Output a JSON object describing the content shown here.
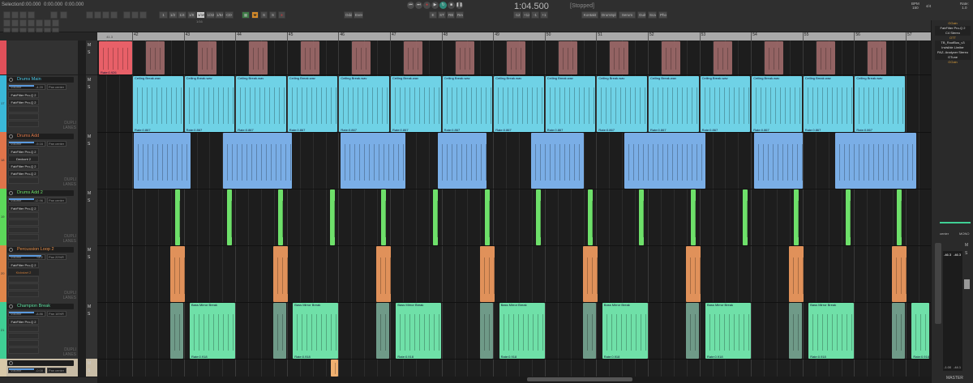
{
  "selection": {
    "label": "Selection:",
    "start": "0:00.000",
    "end": "0:00.000",
    "length": "0:00.000"
  },
  "toolbar": {
    "grid": [
      "1",
      "1/2",
      "1/4",
      "1/8",
      "1/16",
      "1/32",
      "1/64",
      "<3>"
    ],
    "grid_active": "1/16",
    "m_label": "M",
    "s1_label": "S",
    "s2_label": "S",
    "odd": "Odd",
    "even": "Even",
    "edit_btns": [
      "E",
      "ST",
      "RB",
      "Rev"
    ],
    "pitch_btns": [
      "-12",
      "+12",
      "-1",
      "+1"
    ],
    "fx_btns": [
      "Kontakt",
      "DrumSpl",
      "Serum",
      "Guit",
      "Scal",
      "Pho"
    ]
  },
  "transport": {
    "time": "1:04.500",
    "status": "[Stopped]"
  },
  "tempo": {
    "bpm_label": "BPM",
    "bpm": "150",
    "sig": "4/4",
    "rate_label": "Rate:",
    "rate": "1.0"
  },
  "ruler": {
    "bars": [
      "42",
      "43",
      "44",
      "45",
      "46",
      "47",
      "48",
      "49",
      "50",
      "51",
      "52",
      "53",
      "54",
      "55",
      "56",
      "57"
    ],
    "first_half": "41.3"
  },
  "tracks": [
    {
      "name": "",
      "color": "#e0505a",
      "num": "",
      "fx": []
    },
    {
      "name": "Drums Main",
      "color": "#3ab8d8",
      "text_color": "#4cc9e8",
      "num": "17",
      "volume": "-4.20",
      "pan": "center",
      "fx": [
        "FabFilter Pro-Q 2",
        "FabFilter Pro-Q 2"
      ]
    },
    {
      "name": "Drums Add",
      "color": "#e0744a",
      "text_color": "#e07a4a",
      "num": "18",
      "volume": "-9.16",
      "pan": "center",
      "fx": [
        "FabFilter Pro-Q 2",
        "Deckont 2",
        "FabFilter Pro-Q 2",
        "FabFilter Pro-Q 2"
      ]
    },
    {
      "name": "Drums Add 2",
      "color": "#5cd85a",
      "text_color": "#6ee06a",
      "num": "19",
      "volume": "-12.96",
      "pan": "center",
      "fx": [
        "FabFilter Pro-Q 2"
      ]
    },
    {
      "name": "Percussion Loop 2",
      "color": "#e0864a",
      "text_color": "#e8904a",
      "num": "20",
      "volume": "SEZ",
      "pan": "20%R",
      "fx": [
        "FabFilter Pro-Q 2"
      ],
      "fx_off": "Kickstart 2"
    },
    {
      "name": "Champion Break",
      "color": "#3fcf94",
      "text_color": "#5ee0a0",
      "num": "21",
      "volume": "-8.86",
      "pan": "16%R",
      "fx": [
        "FabFilter Pro-Q 2"
      ]
    },
    {
      "name": "",
      "color": "#d8c8a8",
      "num": "",
      "volume": "-0.00",
      "pan": "center",
      "fx": []
    }
  ],
  "labels": {
    "volume": "Volume",
    "pan": "Pan",
    "dupe": "DUPLI\nLANES",
    "m": "M",
    "s": "S"
  },
  "clips": {
    "cyan_name": "Ceiling Break.wav",
    "cyan_rate": "Rate:0.867",
    "red_rate": "Rate:0.926",
    "green_name": "Bass Mirror Break",
    "green_rate": "Rate:0.918"
  },
  "right_panel": {
    "fx_header1": "GGain",
    "fx": [
      "FabFilter Pro-Q 2",
      "C4 Stereo"
    ],
    "fx_header2": "OTT",
    "fx2": [
      "TB_RoofBus_v3",
      "Invisible Limiter",
      "PAZ- Analyzer Stereo",
      "GTune"
    ],
    "fx_header3": "GGain",
    "pan": "center",
    "mono": "MONO",
    "peak_l": "-46.3",
    "peak_r": "-46.3",
    "db_l": "-1.00",
    "db_r": "-44.1",
    "master": "MASTER"
  },
  "colors": {
    "accent": "#d58b2a",
    "record": "#c0393b"
  }
}
